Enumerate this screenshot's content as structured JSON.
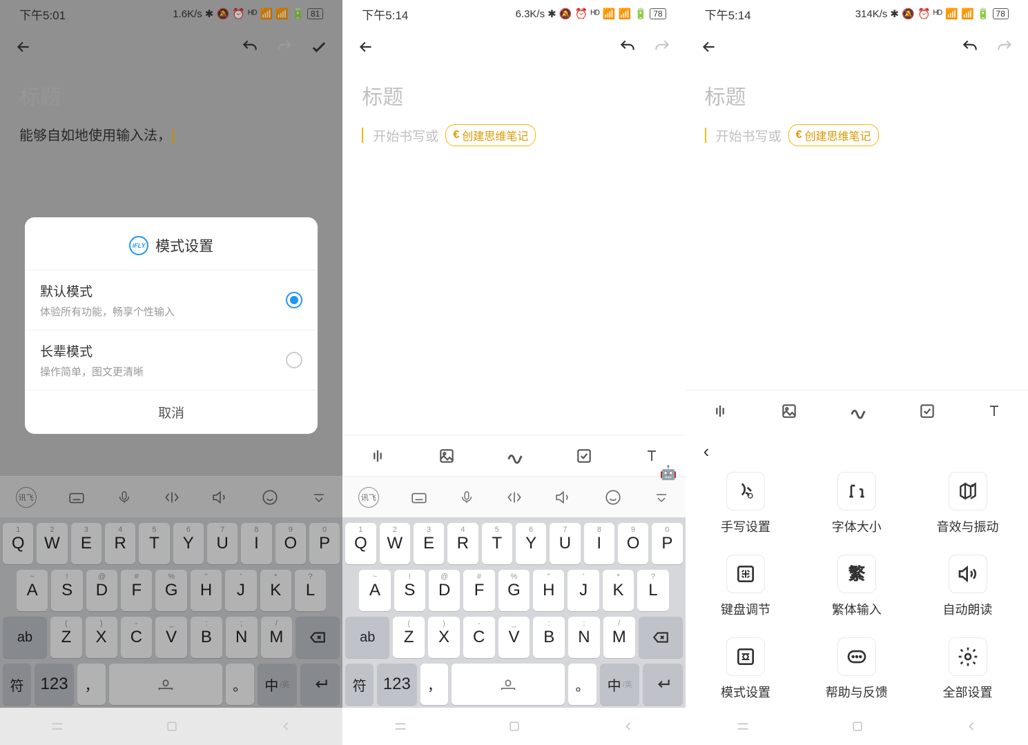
{
  "screens": [
    {
      "status": {
        "time": "下午5:01",
        "speed": "1.6K/s",
        "battery": "81"
      },
      "title_ph": "标题",
      "body": "能够自如地使用输入法，",
      "modal": {
        "title": "模式设置",
        "options": [
          {
            "title": "默认模式",
            "desc": "体验所有功能，畅享个性输入",
            "selected": true
          },
          {
            "title": "长辈模式",
            "desc": "操作简单，图文更清晰",
            "selected": false
          }
        ],
        "cancel": "取消"
      }
    },
    {
      "status": {
        "time": "下午5:14",
        "speed": "6.3K/s",
        "battery": "78"
      },
      "title_ph": "标题",
      "body_ph": "开始书写或",
      "chip": "创建思维笔记"
    },
    {
      "status": {
        "time": "下午5:14",
        "speed": "314K/s",
        "battery": "78"
      },
      "title_ph": "标题",
      "body_ph": "开始书写或",
      "chip": "创建思维笔记",
      "settings": [
        "手写设置",
        "字体大小",
        "音效与振动",
        "键盘调节",
        "繁体输入",
        "自动朗读",
        "模式设置",
        "帮助与反馈",
        "全部设置"
      ]
    }
  ],
  "keyboard": {
    "row1": [
      [
        "1",
        "Q"
      ],
      [
        "2",
        "W"
      ],
      [
        "3",
        "E"
      ],
      [
        "4",
        "R"
      ],
      [
        "5",
        "T"
      ],
      [
        "6",
        "Y"
      ],
      [
        "7",
        "U"
      ],
      [
        "8",
        "I"
      ],
      [
        "9",
        "O"
      ],
      [
        "0",
        "P"
      ]
    ],
    "row2": [
      [
        "~",
        "A"
      ],
      [
        "!",
        "S"
      ],
      [
        "@",
        "D"
      ],
      [
        "#",
        "F"
      ],
      [
        "%",
        "G"
      ],
      [
        "\"",
        "H"
      ],
      [
        "'",
        "J"
      ],
      [
        "*",
        "K"
      ],
      [
        "?",
        "L"
      ]
    ],
    "row3_ab": "ab",
    "row3": [
      [
        "(",
        "Z"
      ],
      [
        ")",
        "X"
      ],
      [
        "-",
        "C"
      ],
      [
        "_",
        "V"
      ],
      [
        ":",
        "B"
      ],
      [
        ";",
        "N"
      ],
      [
        "/",
        "M"
      ]
    ],
    "row4": {
      "sym": "符",
      "num": "123",
      "comma": "，",
      "period": "。",
      "lang": "中",
      "lang_sub": "/英"
    }
  }
}
